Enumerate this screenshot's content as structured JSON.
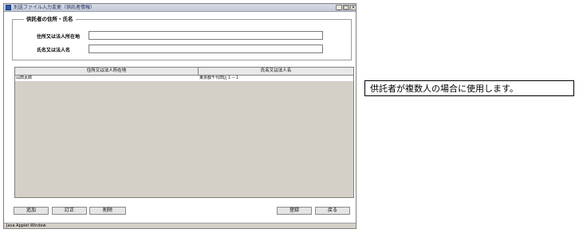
{
  "window": {
    "title": "別送ファイル入力変更（供託者情報）",
    "min_symbol": "_",
    "max_symbol": "□",
    "close_symbol": "×"
  },
  "form": {
    "legend": "供託者の住所・氏名",
    "address_label": "住所又は法人所在地",
    "address_value": "",
    "name_label": "氏名又は法人名",
    "name_value": ""
  },
  "table": {
    "columns": [
      "住所又は法人所在地",
      "氏名又は法人名"
    ],
    "rows": [
      [
        "山田太郎",
        "東京都千代田区１－１"
      ]
    ]
  },
  "buttons": {
    "add": "追加",
    "edit": "訂正",
    "delete": "削除",
    "register": "登録",
    "back": "戻る"
  },
  "status": {
    "text": "Java Applet Window"
  },
  "callout": {
    "text": "供託者が複数人の場合に使用します。"
  }
}
